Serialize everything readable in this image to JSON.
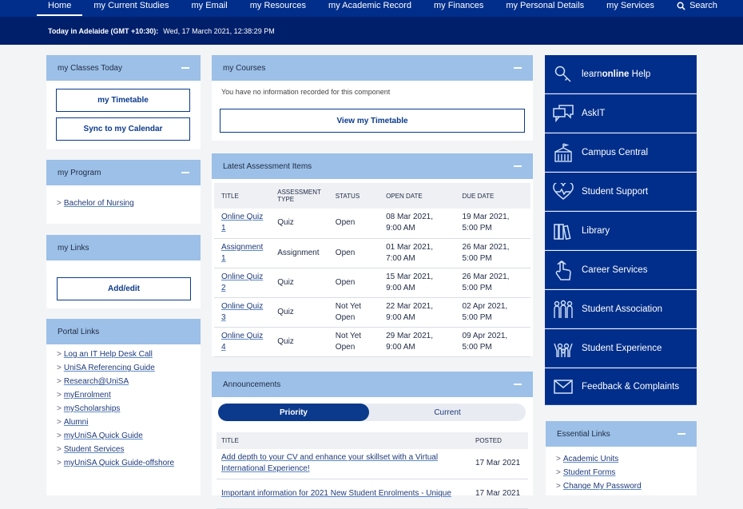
{
  "nav": {
    "items": [
      "Home",
      "my Current Studies",
      "my Email",
      "my Resources",
      "my Academic Record",
      "my Finances",
      "my Personal Details",
      "my Services"
    ],
    "search_label": "Search"
  },
  "datebar": {
    "label": "Today in Adelaide (GMT +10:30):",
    "value": "Wed, 17 March 2021, 12:38:29 PM"
  },
  "classes": {
    "title": "my Classes Today",
    "timetable_btn": "my Timetable",
    "calendar_btn": "Sync to my Calendar"
  },
  "program": {
    "title": "my Program",
    "link": "Bachelor of Nursing"
  },
  "links": {
    "title": "my Links",
    "add_btn": "Add/edit"
  },
  "portal": {
    "title": "Portal Links",
    "items": [
      "Log an IT Help Desk Call",
      "UniSA Referencing Guide",
      "Research@UniSA",
      "myEnrolment",
      "myScholarships",
      "Alumni",
      "myUniSA Quick Guide",
      "Student Services",
      "myUniSA Quick Guide-offshore"
    ]
  },
  "courses": {
    "title": "my Courses",
    "empty_msg": "You have no information recorded for this component",
    "btn": "View my Timetable"
  },
  "assessment": {
    "title": "Latest Assessment Items",
    "headers": [
      "TITLE",
      "ASSESSMENT TYPE",
      "STATUS",
      "OPEN DATE",
      "DUE DATE"
    ],
    "rows": [
      {
        "title": "Online Quiz 1",
        "type": "Quiz",
        "status": "Open",
        "open": "08 Mar 2021, 9:00 AM",
        "due": "19 Mar 2021, 5:00 PM"
      },
      {
        "title": "Assignment 1",
        "type": "Assignment",
        "status": "Open",
        "open": "01 Mar 2021, 7:00 AM",
        "due": "26 Mar 2021, 5:00 PM"
      },
      {
        "title": "Online Quiz 2",
        "type": "Quiz",
        "status": "Open",
        "open": "15 Mar 2021, 9:00 AM",
        "due": "26 Mar 2021, 5:00 PM"
      },
      {
        "title": "Online Quiz 3",
        "type": "Quiz",
        "status": "Not Yet Open",
        "open": "22 Mar 2021, 9:00 AM",
        "due": "02 Apr 2021, 5:00 PM"
      },
      {
        "title": "Online Quiz 4",
        "type": "Quiz",
        "status": "Not Yet Open",
        "open": "29 Mar 2021, 9:00 AM",
        "due": "09 Apr 2021, 5:00 PM"
      }
    ]
  },
  "announcements": {
    "title": "Announcements",
    "tabs": [
      "Priority",
      "Current"
    ],
    "headers": [
      "TITLE",
      "POSTED"
    ],
    "rows": [
      {
        "title": "Add depth to your CV and enhance your skillset with a Virtual International Experience!",
        "posted": "17 Mar 2021"
      },
      {
        "title": "Important information for 2021 New Student Enrolments - Unique",
        "posted": "17 Mar 2021"
      }
    ]
  },
  "services": {
    "items": [
      {
        "label_pre": "learn",
        "label_bold": "online",
        "label_post": " Help",
        "icon": "search-icon"
      },
      {
        "label": "AskIT",
        "icon": "chat-icon"
      },
      {
        "label": "Campus Central",
        "icon": "building-icon"
      },
      {
        "label": "Student Support",
        "icon": "heart-pulse-icon"
      },
      {
        "label": "Library",
        "icon": "books-icon"
      },
      {
        "label": "Career Services",
        "icon": "hand-pointer-icon"
      },
      {
        "label": "Student Association",
        "icon": "people-icon"
      },
      {
        "label": "Student Experience",
        "icon": "celebrate-icon"
      },
      {
        "label": "Feedback & Complaints",
        "icon": "envelope-icon"
      }
    ]
  },
  "essential": {
    "title": "Essential Links",
    "items": [
      "Academic Units",
      "Student Forms",
      "Change My Password"
    ]
  },
  "colors": {
    "nav_bg": "#002e8a",
    "datebar_bg": "#001f6b",
    "panel_header": "#9cc0e7",
    "service_bg": "#002e8a"
  }
}
